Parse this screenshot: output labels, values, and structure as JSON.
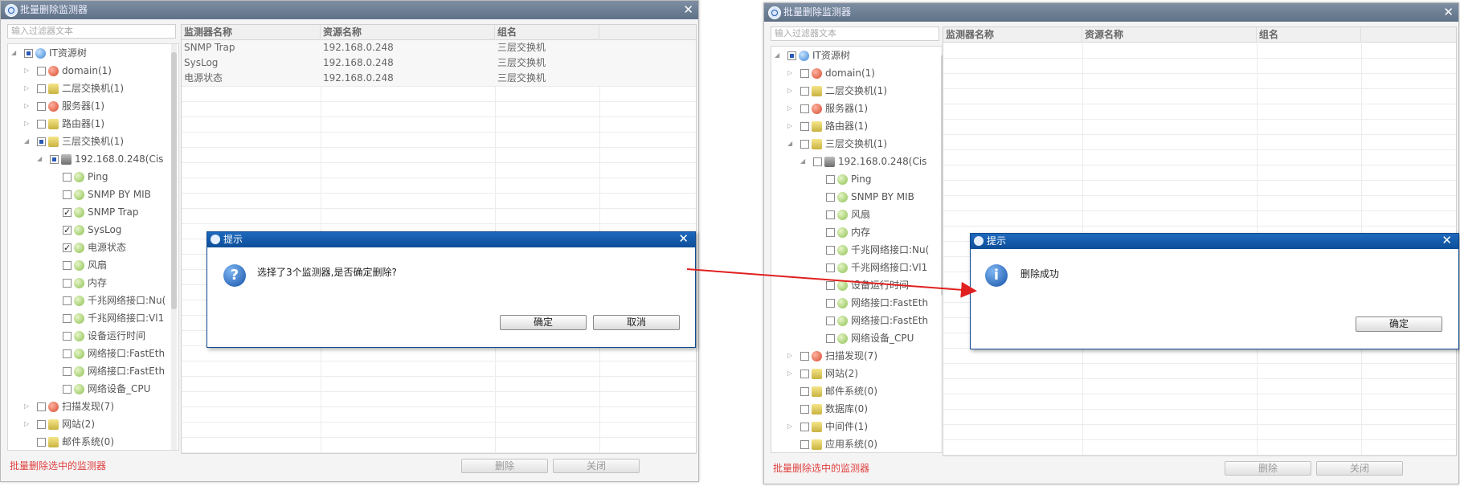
{
  "left": {
    "title": "批量删除监测器",
    "filter_placeholder": "输入过滤器文本",
    "tree": [
      {
        "label": "IT资源树",
        "cb": "partial",
        "icon": "globe",
        "level": 0,
        "exp": "◢"
      },
      {
        "label": "domain(1)",
        "cb": "none",
        "icon": "red",
        "level": 1,
        "exp": "▷"
      },
      {
        "label": "二层交换机(1)",
        "cb": "none",
        "icon": "folder",
        "level": 1,
        "exp": "▷"
      },
      {
        "label": "服务器(1)",
        "cb": "none",
        "icon": "red",
        "level": 1,
        "exp": "▷"
      },
      {
        "label": "路由器(1)",
        "cb": "none",
        "icon": "folder",
        "level": 1,
        "exp": "▷"
      },
      {
        "label": "三层交换机(1)",
        "cb": "partial",
        "icon": "folder",
        "level": 1,
        "exp": "◢"
      },
      {
        "label": "192.168.0.248(Cis",
        "cb": "partial",
        "icon": "device",
        "level": 2,
        "exp": "◢"
      },
      {
        "label": "Ping",
        "cb": "none",
        "icon": "green",
        "level": 3,
        "exp": ""
      },
      {
        "label": "SNMP BY MIB",
        "cb": "none",
        "icon": "green",
        "level": 3,
        "exp": ""
      },
      {
        "label": "SNMP Trap",
        "cb": "checked",
        "icon": "green",
        "level": 3,
        "exp": ""
      },
      {
        "label": "SysLog",
        "cb": "checked",
        "icon": "green",
        "level": 3,
        "exp": ""
      },
      {
        "label": "电源状态",
        "cb": "checked",
        "icon": "green",
        "level": 3,
        "exp": ""
      },
      {
        "label": "风扇",
        "cb": "none",
        "icon": "green",
        "level": 3,
        "exp": ""
      },
      {
        "label": "内存",
        "cb": "none",
        "icon": "green",
        "level": 3,
        "exp": ""
      },
      {
        "label": "千兆网络接口:Nu(",
        "cb": "none",
        "icon": "green",
        "level": 3,
        "exp": ""
      },
      {
        "label": "千兆网络接口:Vl1",
        "cb": "none",
        "icon": "green",
        "level": 3,
        "exp": ""
      },
      {
        "label": "设备运行时间",
        "cb": "none",
        "icon": "green",
        "level": 3,
        "exp": ""
      },
      {
        "label": "网络接口:FastEth",
        "cb": "none",
        "icon": "green",
        "level": 3,
        "exp": ""
      },
      {
        "label": "网络接口:FastEth",
        "cb": "none",
        "icon": "green",
        "level": 3,
        "exp": ""
      },
      {
        "label": "网络设备_CPU",
        "cb": "none",
        "icon": "green",
        "level": 3,
        "exp": ""
      },
      {
        "label": "扫描发现(7)",
        "cb": "none",
        "icon": "red",
        "level": 1,
        "exp": "▷"
      },
      {
        "label": "网站(2)",
        "cb": "none",
        "icon": "folder",
        "level": 1,
        "exp": "▷"
      },
      {
        "label": "邮件系统(0)",
        "cb": "none",
        "icon": "folder",
        "level": 1,
        "exp": ""
      }
    ],
    "columns": [
      "监测器名称",
      "资源名称",
      "组名"
    ],
    "rows": [
      [
        "SNMP Trap",
        "192.168.0.248",
        "三层交换机"
      ],
      [
        "SysLog",
        "192.168.0.248",
        "三层交换机"
      ],
      [
        "电源状态",
        "192.168.0.248",
        "三层交换机"
      ]
    ],
    "note": "批量删除选中的监测器",
    "delete_label": "删除",
    "close_label": "关闭",
    "dialog": {
      "title": "提示",
      "message": "选择了3个监测器,是否确定删除?",
      "icon_glyph": "?",
      "ok_label": "确定",
      "cancel_label": "取消"
    }
  },
  "right": {
    "title": "批量删除监测器",
    "filter_placeholder": "输入过滤器文本",
    "tree": [
      {
        "label": "IT资源树",
        "cb": "partial",
        "icon": "globe",
        "level": 0,
        "exp": "◢"
      },
      {
        "label": "domain(1)",
        "cb": "none",
        "icon": "red",
        "level": 1,
        "exp": "▷"
      },
      {
        "label": "二层交换机(1)",
        "cb": "none",
        "icon": "folder",
        "level": 1,
        "exp": "▷"
      },
      {
        "label": "服务器(1)",
        "cb": "none",
        "icon": "red",
        "level": 1,
        "exp": "▷"
      },
      {
        "label": "路由器(1)",
        "cb": "none",
        "icon": "folder",
        "level": 1,
        "exp": "▷"
      },
      {
        "label": "三层交换机(1)",
        "cb": "none",
        "icon": "folder",
        "level": 1,
        "exp": "◢"
      },
      {
        "label": "192.168.0.248(Cis",
        "cb": "none",
        "icon": "device",
        "level": 2,
        "exp": "◢"
      },
      {
        "label": "Ping",
        "cb": "none",
        "icon": "green",
        "level": 3,
        "exp": ""
      },
      {
        "label": "SNMP BY MIB",
        "cb": "none",
        "icon": "green",
        "level": 3,
        "exp": ""
      },
      {
        "label": "风扇",
        "cb": "none",
        "icon": "green",
        "level": 3,
        "exp": ""
      },
      {
        "label": "内存",
        "cb": "none",
        "icon": "green",
        "level": 3,
        "exp": ""
      },
      {
        "label": "千兆网络接口:Nu(",
        "cb": "none",
        "icon": "green",
        "level": 3,
        "exp": ""
      },
      {
        "label": "千兆网络接口:Vl1",
        "cb": "none",
        "icon": "green",
        "level": 3,
        "exp": ""
      },
      {
        "label": "设备运行时间",
        "cb": "none",
        "icon": "green",
        "level": 3,
        "exp": ""
      },
      {
        "label": "网络接口:FastEth",
        "cb": "none",
        "icon": "green",
        "level": 3,
        "exp": ""
      },
      {
        "label": "网络接口:FastEth",
        "cb": "none",
        "icon": "green",
        "level": 3,
        "exp": ""
      },
      {
        "label": "网络设备_CPU",
        "cb": "none",
        "icon": "green",
        "level": 3,
        "exp": ""
      },
      {
        "label": "扫描发现(7)",
        "cb": "none",
        "icon": "red",
        "level": 1,
        "exp": "▷"
      },
      {
        "label": "网站(2)",
        "cb": "none",
        "icon": "folder",
        "level": 1,
        "exp": "▷"
      },
      {
        "label": "邮件系统(0)",
        "cb": "none",
        "icon": "folder",
        "level": 1,
        "exp": ""
      },
      {
        "label": "数据库(0)",
        "cb": "none",
        "icon": "folder",
        "level": 1,
        "exp": ""
      },
      {
        "label": "中间件(1)",
        "cb": "none",
        "icon": "folder",
        "level": 1,
        "exp": "▷"
      },
      {
        "label": "应用系统(0)",
        "cb": "none",
        "icon": "folder",
        "level": 1,
        "exp": ""
      }
    ],
    "columns": [
      "监测器名称",
      "资源名称",
      "组名"
    ],
    "rows": [],
    "note": "批量删除选中的监测器",
    "delete_label": "删除",
    "close_label": "关闭",
    "dialog": {
      "title": "提示",
      "message": "删除成功",
      "icon_glyph": "i",
      "ok_label": "确定"
    }
  },
  "colors": {
    "dialog_title": "#0d4e98",
    "arrow": "#e02020",
    "note": "#e04040"
  }
}
